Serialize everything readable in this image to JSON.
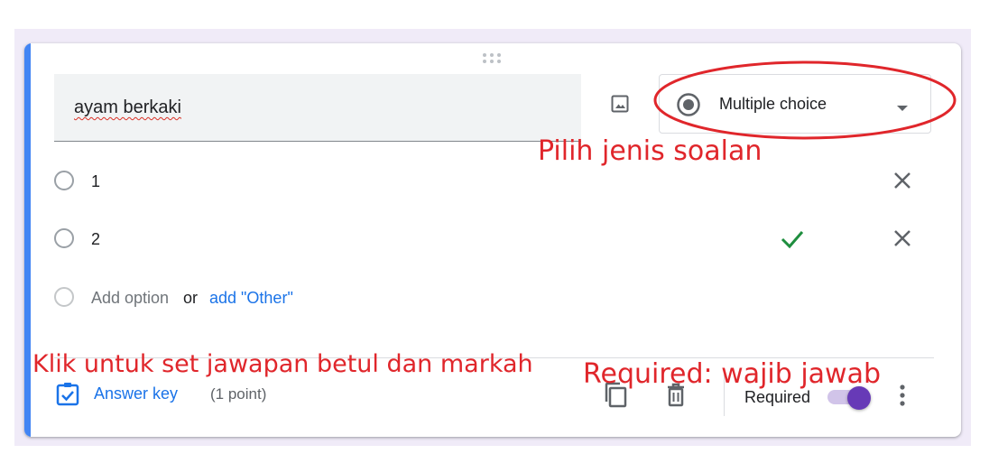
{
  "question": {
    "title": "ayam berkaki",
    "type_label": "Multiple choice",
    "options": [
      {
        "label": "1",
        "marked_correct": false
      },
      {
        "label": "2",
        "marked_correct": true
      }
    ],
    "add_option_label": "Add option",
    "or_label": "or",
    "add_other_label": "add \"Other\""
  },
  "footer": {
    "answer_key_label": "Answer key",
    "points_label": "(1 point)",
    "required_label": "Required",
    "required_on": true
  },
  "annotations": {
    "type_hint": "Pilih jenis soalan",
    "answer_key_hint": "Klik untuk set jawapan betul dan markah",
    "required_hint": "Required: wajib jawab"
  },
  "colors": {
    "accent_bar": "#4285f4",
    "toggle_thumb": "#673ab7",
    "toggle_track": "#d1c4e9",
    "link": "#1a73e8",
    "correct_check": "#1e8e3e",
    "annotation": "#e0262b",
    "page_band": "#f0ebf8"
  },
  "icons": {
    "drag": "drag-handle-icon",
    "image": "image-icon",
    "type": "radio-button-checked-icon",
    "dropdown": "caret-down-icon",
    "remove": "close-icon",
    "correct": "check-icon",
    "answer_key": "assignment-check-icon",
    "duplicate": "copy-icon",
    "delete": "trash-icon",
    "more": "more-vert-icon"
  }
}
